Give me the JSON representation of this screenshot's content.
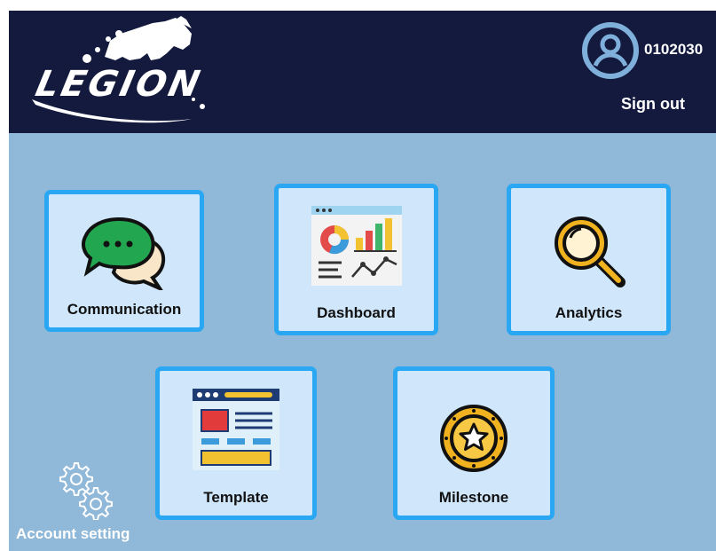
{
  "header": {
    "logo_text": "LEGION",
    "user_id": "0102030",
    "sign_out_label": "Sign out"
  },
  "tiles": [
    {
      "label": "Communication",
      "icon": "chat-bubbles-icon"
    },
    {
      "label": "Dashboard",
      "icon": "dashboard-charts-icon"
    },
    {
      "label": "Analytics",
      "icon": "magnifier-icon"
    },
    {
      "label": "Template",
      "icon": "template-layout-icon"
    },
    {
      "label": "Milestone",
      "icon": "star-coin-icon"
    }
  ],
  "footer": {
    "account_setting_label": "Account setting",
    "icon": "gears-icon"
  },
  "colors": {
    "header_bg": "#141a3d",
    "page_bg": "#8fb8d9",
    "tile_bg": "#cfe6fb",
    "tile_border": "#2aa7f2",
    "user_icon": "#7fb0dc"
  }
}
